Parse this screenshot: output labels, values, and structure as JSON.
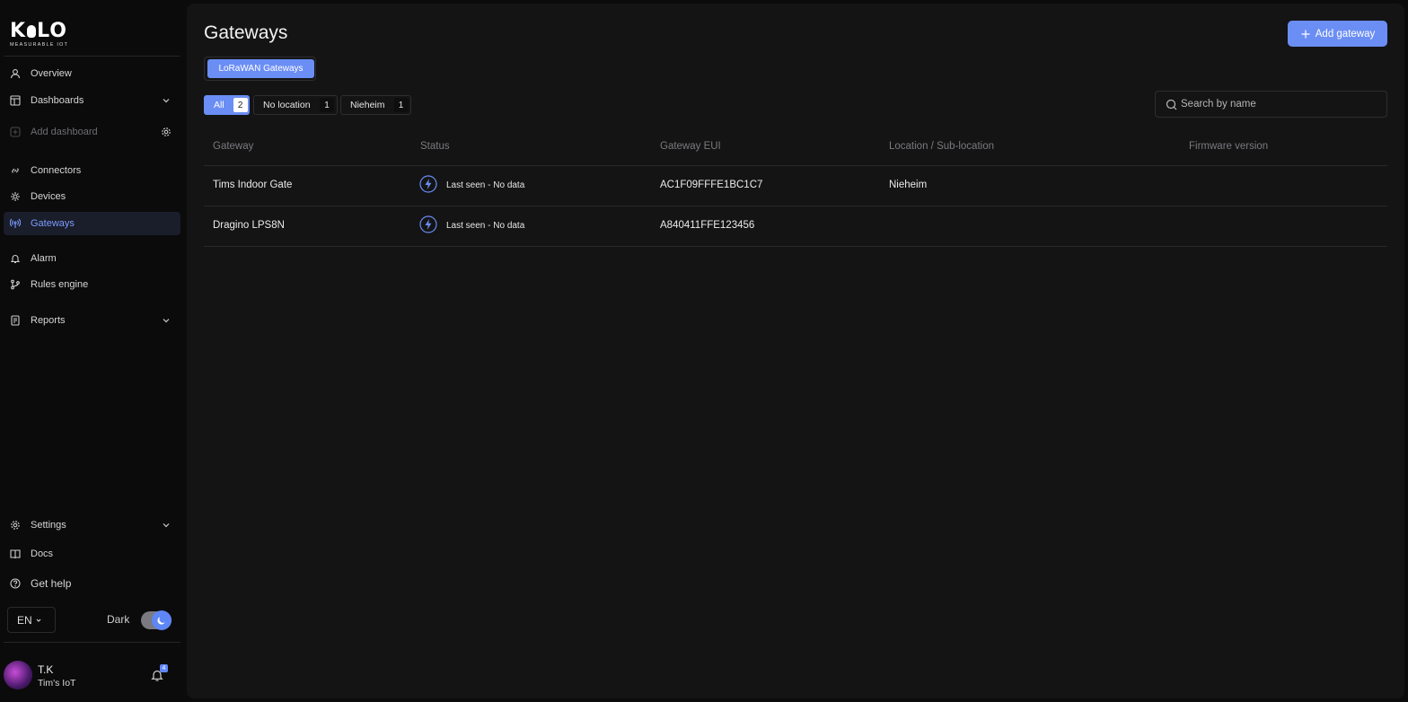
{
  "brand": {
    "name": "K LO",
    "tagline": "MEASURABLE IOT"
  },
  "sidebar": {
    "items": [
      {
        "label": "Overview",
        "icon": "user-icon"
      },
      {
        "label": "Dashboards",
        "icon": "dashboard-icon"
      },
      {
        "label": "Add dashboard",
        "icon": "plus-square-icon"
      },
      {
        "label": "Connectors",
        "icon": "connectors-icon"
      },
      {
        "label": "Devices",
        "icon": "devices-icon"
      },
      {
        "label": "Gateways",
        "icon": "gateway-icon",
        "active": true
      },
      {
        "label": "Alarm",
        "icon": "bell-icon"
      },
      {
        "label": "Rules engine",
        "icon": "branch-icon"
      },
      {
        "label": "Reports",
        "icon": "report-icon"
      }
    ],
    "bottom_items": [
      {
        "label": "Settings",
        "icon": "gear-icon"
      },
      {
        "label": "Docs",
        "icon": "book-icon"
      },
      {
        "label": "Get help",
        "icon": "help-icon"
      }
    ],
    "language": "EN",
    "theme_label": "Dark",
    "theme_dark": true,
    "user": {
      "name": "T.K",
      "org": "Tim's IoT",
      "notifications": "4"
    }
  },
  "page": {
    "title": "Gateways",
    "add_button": "Add gateway",
    "tab": "LoRaWAN Gateways",
    "filters": [
      {
        "label": "All",
        "count": "2",
        "selected": true
      },
      {
        "label": "No location",
        "count": "1"
      },
      {
        "label": "Nieheim",
        "count": "1"
      }
    ],
    "search_placeholder": "Search by name"
  },
  "table": {
    "columns": [
      "Gateway",
      "Status",
      "Gateway EUI",
      "Location / Sub-location",
      "Firmware version"
    ],
    "rows": [
      {
        "gateway": "Tims Indoor Gate",
        "status": "Last seen - No data",
        "eui": "AC1F09FFFE1BC1C7",
        "location": "Nieheim",
        "firmware": ""
      },
      {
        "gateway": "Dragino LPS8N",
        "status": "Last seen - No data",
        "eui": "A840411FFE123456",
        "location": "",
        "firmware": ""
      }
    ]
  },
  "colors": {
    "accent": "#6b8ef5",
    "active_nav_text": "#7c9cff",
    "panel": "#141415",
    "background": "#0b0b0c"
  }
}
